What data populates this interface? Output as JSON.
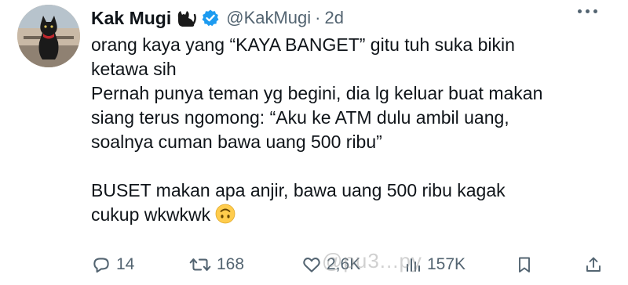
{
  "author": {
    "display_name": "Kak Mugi",
    "handle": "@KakMugi",
    "separator": "·",
    "time": "2d",
    "name_emoji": "cat-emoji",
    "verified": true
  },
  "tweet": {
    "lines": [
      "orang kaya yang “KAYA BANGET” gitu tuh suka bikin",
      "ketawa sih",
      "Pernah punya teman yg begini, dia lg keluar buat makan",
      "siang terus ngomong: “Aku ke ATM dulu ambil uang,",
      "soalnya cuman bawa uang 500 ribu”",
      "",
      "BUSET makan apa anjir, bawa uang 500 ribu kagak",
      "cukup wkwkwk"
    ],
    "trailing_emoji": "upside-down-face-emoji"
  },
  "actions": {
    "replies": "14",
    "retweets": "168",
    "likes": "2,6K",
    "views": "157K"
  },
  "watermark": "@pu3...py",
  "colors": {
    "text": "#0f1419",
    "secondary": "#536471",
    "verified": "#1d9bf0"
  }
}
